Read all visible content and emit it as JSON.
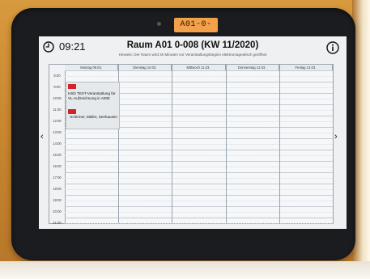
{
  "device": {
    "room_plate": "A01-0-008"
  },
  "header": {
    "time": "09:21",
    "title": "Raum A01 0-008 (KW 11/2020)",
    "hint": "Hinweis: Der Raum wird 30 Minuten vor Veranstaltungsbeginn elektromagnetisch geöffnet",
    "clock_icon": "clock-icon",
    "info_icon": "info-icon"
  },
  "calendar": {
    "days": [
      "Montag 09.03.",
      "Dienstag 10.03.",
      "Mittwoch 11.03.",
      "Donnerstag 12.03.",
      "Freitag 13.03."
    ],
    "times": [
      "8:00",
      "9:00",
      "10:00",
      "11:00",
      "12:00",
      "13:00",
      "14:00",
      "15:00",
      "16:00",
      "17:00",
      "18:00",
      "19:00",
      "20:00",
      "21:00"
    ],
    "event": {
      "title": "HSD TEST-Veranstaltung für VL-Aufzeichnung in A008",
      "people": "Schirmer, Müller, Seehausen",
      "day": "Montag 09.03.",
      "start": "9:00",
      "end": "12:00"
    }
  },
  "nav": {
    "prev": "‹",
    "next": "›"
  }
}
